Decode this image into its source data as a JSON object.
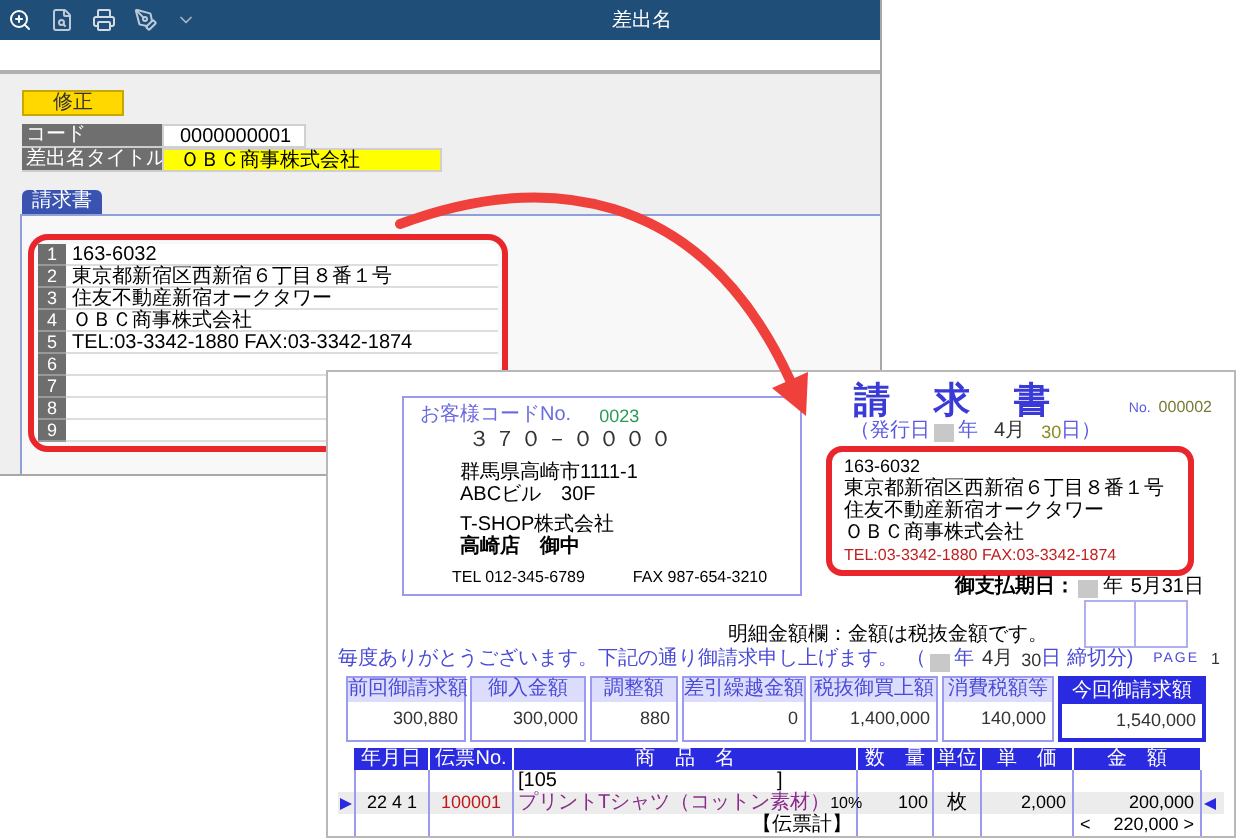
{
  "app_window": {
    "title": "差出名",
    "mode_button": "修正",
    "fields": [
      {
        "label": "コード",
        "value": "0000000001",
        "highlighted": false
      },
      {
        "label": "差出名タイトル",
        "value": "ＯＢＣ商事株式会社",
        "highlighted": true
      }
    ],
    "tabs": [
      {
        "label": "請求書",
        "selected": true
      }
    ],
    "lines": [
      {
        "number": "1",
        "text": "163-6032"
      },
      {
        "number": "2",
        "text": "東京都新宿区西新宿６丁目８番１号"
      },
      {
        "number": "3",
        "text": "住友不動産新宿オークタワー"
      },
      {
        "number": "4",
        "text": "ＯＢＣ商事株式会社"
      },
      {
        "number": "5",
        "text": "TEL:03-3342-1880 FAX:03-3342-1874"
      },
      {
        "number": "6"
      },
      {
        "number": "7"
      },
      {
        "number": "8"
      },
      {
        "number": "9"
      }
    ]
  },
  "invoice": {
    "customer_code_label": "お客様コードNo.",
    "customer_code": "0023",
    "postal_code": "３７０－００００",
    "address_lines": [
      "群馬県高崎市1111-1",
      "ABCビル　30F"
    ],
    "recipient_lines": [
      "T-SHOP株式会社",
      "高崎店　御中"
    ],
    "tel": "TEL 012-345-6789",
    "fax": "FAX 987-654-3210",
    "title": "請　求　書",
    "number_label": "No.",
    "number": "000002",
    "issue_date": {
      "prefix": "（発行日",
      "year_unit": "年",
      "month": "4月",
      "day": "30",
      "suffix": "日）"
    },
    "sender_lines": [
      "163-6032",
      "東京都新宿区西新宿６丁目８番１号",
      "住友不動産新宿オークタワー",
      "ＯＢＣ商事株式会社",
      "TEL:03-3342-1880 FAX:03-3342-1874"
    ],
    "due_date": {
      "label": "御支払期日：",
      "year_unit": "年",
      "date": "5月31日"
    },
    "note": "明細金額欄：金額は税抜金額です。",
    "greeting": "毎度ありがとうございます。下記の通り御請求申し上げます。",
    "period": {
      "prefix": "（",
      "year_unit": "年",
      "month": "4月",
      "day": "30",
      "suffix": "日 締切分)"
    },
    "page": {
      "label": "PAGE",
      "number": "1"
    },
    "summary": [
      {
        "label": "前回御請求額",
        "value": "300,880",
        "emphasized": false
      },
      {
        "label": "御入金額",
        "value": "300,000",
        "emphasized": false
      },
      {
        "label": "調整額",
        "value": "880",
        "emphasized": false
      },
      {
        "label": "差引繰越金額",
        "value": "0",
        "emphasized": false
      },
      {
        "label": "税抜御買上額",
        "value": "1,400,000",
        "emphasized": false
      },
      {
        "label": "消費税額等",
        "value": "140,000",
        "emphasized": false
      },
      {
        "label": "今回御請求額",
        "value": "1,540,000",
        "emphasized": true
      }
    ],
    "columns": [
      "年月日",
      "伝票No.",
      "商　品　名",
      "数　量",
      "単位",
      "単　価",
      "金　額"
    ],
    "rows": [
      {
        "selected": false,
        "product": "[105　　　　　　　　　　　]"
      },
      {
        "selected": true,
        "date": "22 4 1",
        "slip_no": "100001",
        "product": "プリントTシャツ（コットン素材）",
        "tax_rate": "10%",
        "quantity": "100",
        "unit": "枚",
        "unit_price": "2,000",
        "amount": "200,000"
      },
      {
        "selected": false,
        "total_label": "【伝票計】",
        "total_open": "<",
        "amount": "220,000 >"
      }
    ]
  }
}
